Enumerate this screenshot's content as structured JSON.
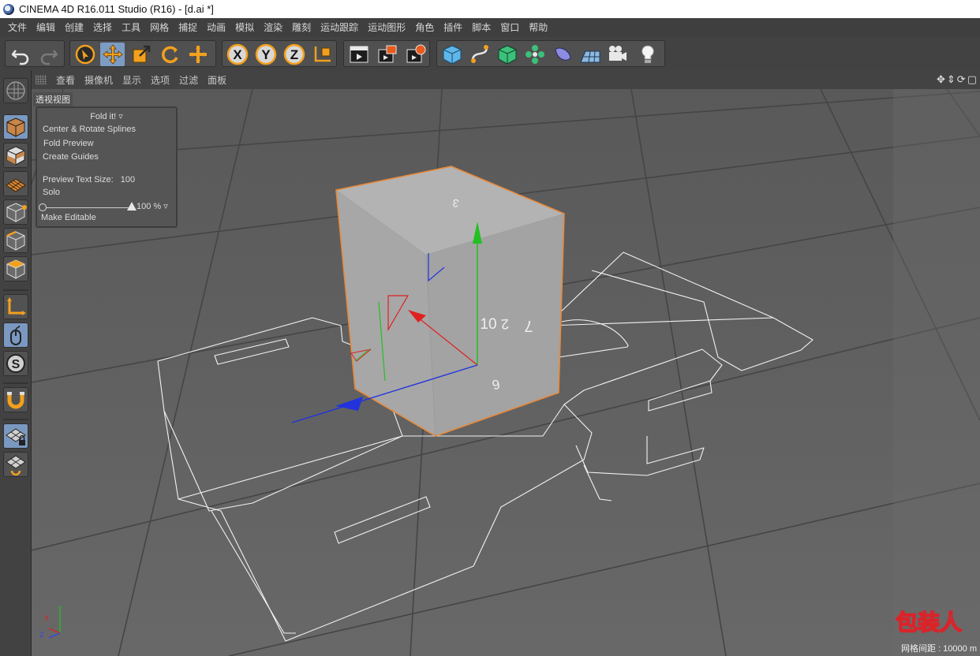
{
  "window": {
    "title": "CINEMA 4D R16.011 Studio (R16) - [d.ai *]"
  },
  "menu": [
    "文件",
    "编辑",
    "创建",
    "选择",
    "工具",
    "网格",
    "捕捉",
    "动画",
    "模拟",
    "渲染",
    "雕刻",
    "运动跟踪",
    "运动图形",
    "角色",
    "插件",
    "脚本",
    "窗口",
    "帮助"
  ],
  "toolbar": {
    "icons": [
      "undo-icon",
      "redo-icon",
      "live-select-icon",
      "move-icon",
      "scale-icon",
      "rotate-icon",
      "add-icon",
      "x-axis-lock-icon",
      "y-axis-lock-icon",
      "z-axis-lock-icon",
      "coordinate-system-icon",
      "render-view-icon",
      "render-picture-viewer-icon",
      "edit-render-settings-icon",
      "cube-icon",
      "spline-pen-icon",
      "subdivision-surface-icon",
      "cloner-icon",
      "deformer-icon",
      "floor-icon",
      "camera-icon",
      "light-icon"
    ],
    "axis_labels": {
      "x": "X",
      "y": "Y",
      "z": "Z"
    }
  },
  "left_tools": [
    "make-editable-icon",
    "model-mode-icon",
    "texture-mode-icon",
    "workplane-mode-icon",
    "points-mode-icon",
    "edges-mode-icon",
    "polygons-mode-icon",
    "axis-mode-icon",
    "tweak-mode-icon",
    "solo-mode-icon",
    "snap-icon",
    "workplane-lock-icon",
    "workplane-align-icon"
  ],
  "viewport": {
    "menu": [
      "查看",
      "摄像机",
      "显示",
      "选项",
      "过滤",
      "面板"
    ],
    "label": "透视视图",
    "axis": {
      "x": "X",
      "y": "Y",
      "z": "Z"
    },
    "grid_status": "网格间距 : 10000 m"
  },
  "fold_panel": {
    "title": "Fold it!",
    "items": [
      "Center & Rotate Splines",
      "Fold Preview",
      "Create Guides"
    ],
    "preview_text_size_label": "Preview Text Size:",
    "preview_text_size_value": "100",
    "solo_label": "Solo",
    "fold_percent": "100 %",
    "fold_fraction": 1.0,
    "make_editable_label": "Make Editable"
  },
  "box_text": {
    "top": "3",
    "front_left": "10",
    "right_a": "2",
    "right_b": "7",
    "right_c": "6"
  },
  "watermark": "包装人",
  "colors": {
    "selection_outline": "#e88a3a",
    "axis_x": "#e02020",
    "axis_y": "#22c022",
    "axis_z": "#2233dd",
    "active_tool": "#7d9cc4",
    "tool_orange": "#f2a01e"
  }
}
